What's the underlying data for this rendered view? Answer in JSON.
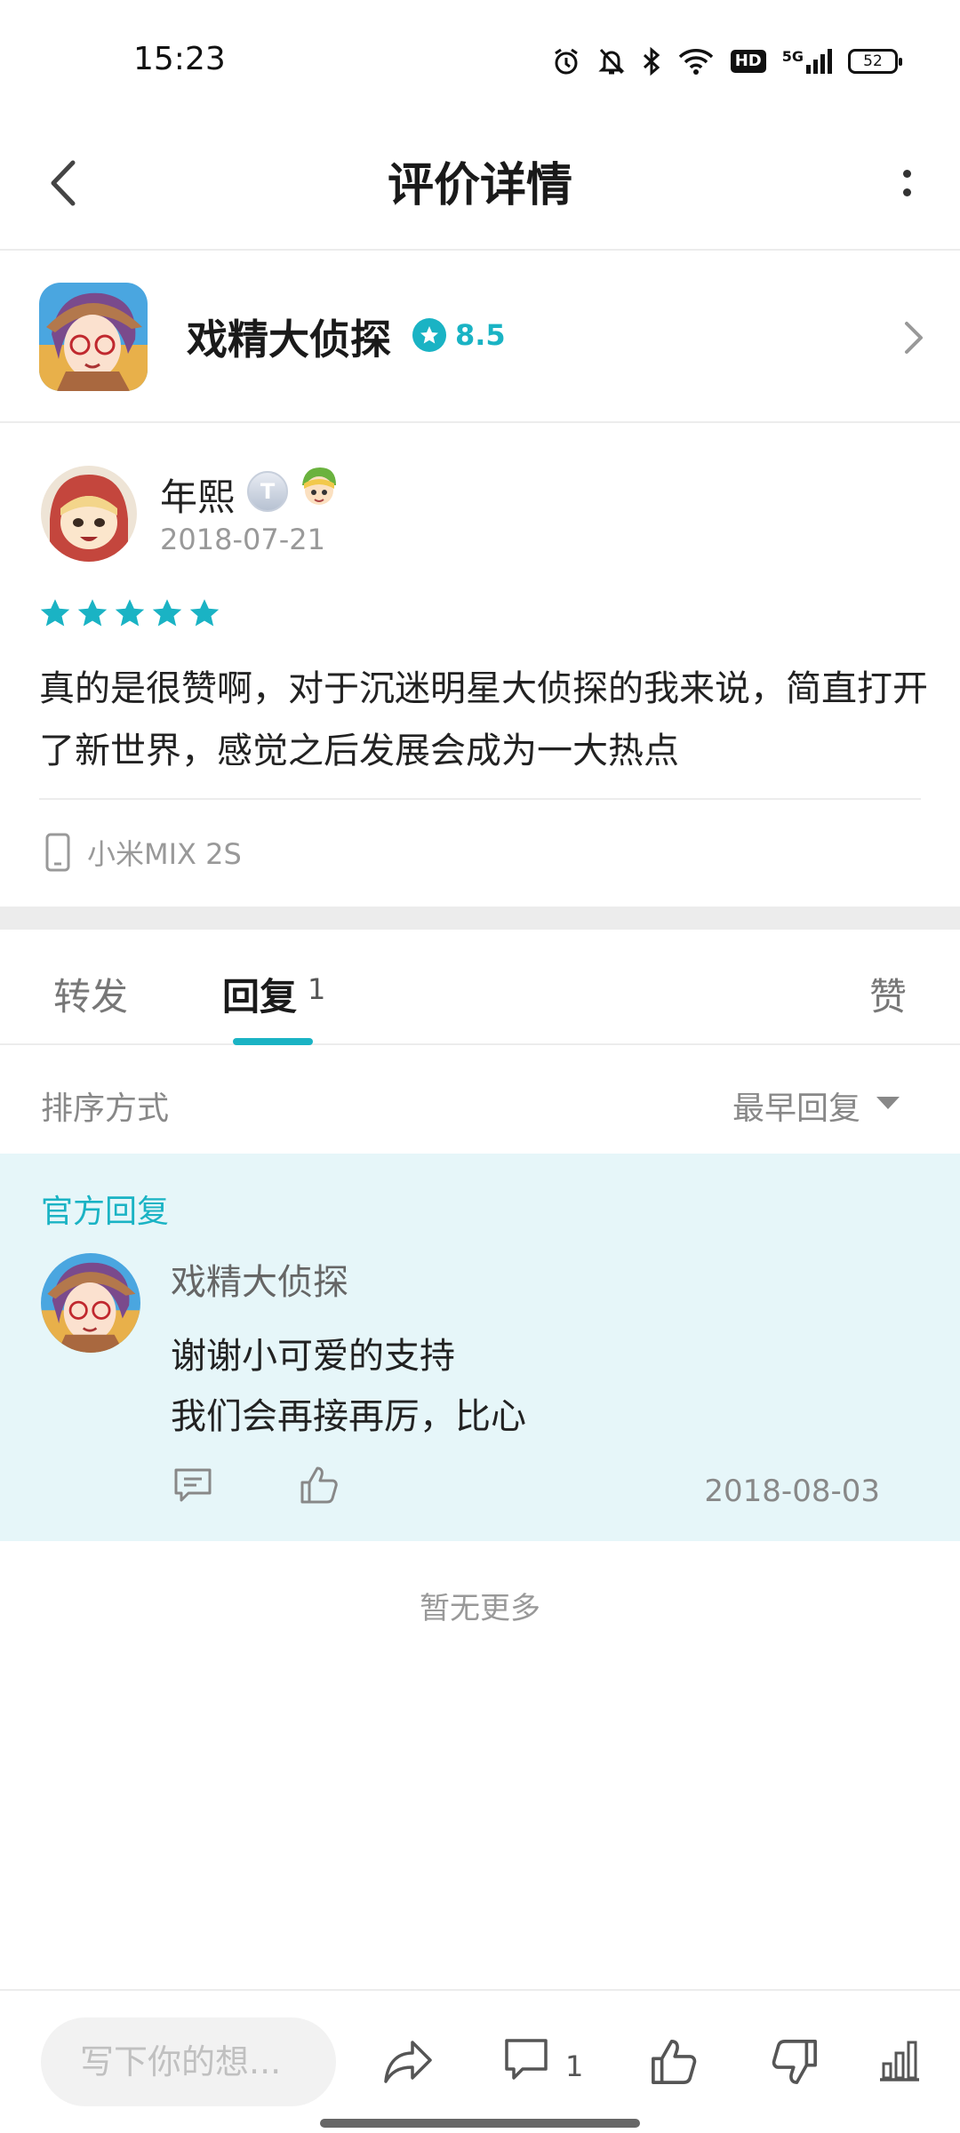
{
  "status_bar": {
    "time": "15:23",
    "network": "5G",
    "hd": "HD",
    "battery": "52",
    "icons": [
      "alarm-icon",
      "bell-off-icon",
      "bluetooth-icon",
      "wifi-icon",
      "hd-icon",
      "signal-icon",
      "battery-icon"
    ]
  },
  "header": {
    "title": "评价详情",
    "back_icon": "chevron-left-icon",
    "more_icon": "more-vertical-icon"
  },
  "app": {
    "name": "戏精大侦探",
    "score": "8.5",
    "accent_color": "#1ab3c4"
  },
  "review": {
    "user_name": "年熙",
    "level_badge": "T",
    "date": "2018-07-21",
    "stars": 5,
    "text": "真的是很赞啊，对于沉迷明星大侦探的我来说，简直打开了新世界，感觉之后发展会成为一大热点",
    "device": "小米MIX 2S"
  },
  "tabs": {
    "forward": "转发",
    "reply": "回复",
    "reply_count": "1",
    "like": "赞",
    "active": "reply"
  },
  "sort": {
    "label": "排序方式",
    "value": "最早回复"
  },
  "official_reply": {
    "label": "官方回复",
    "name": "戏精大侦探",
    "line1": "谢谢小可爱的支持",
    "line2": "我们会再接再厉，比心",
    "date": "2018-08-03",
    "background_color": "#e6f6f9"
  },
  "no_more": "暂无更多",
  "bottom_bar": {
    "placeholder": "写下你的想...",
    "comment_count": "1"
  }
}
